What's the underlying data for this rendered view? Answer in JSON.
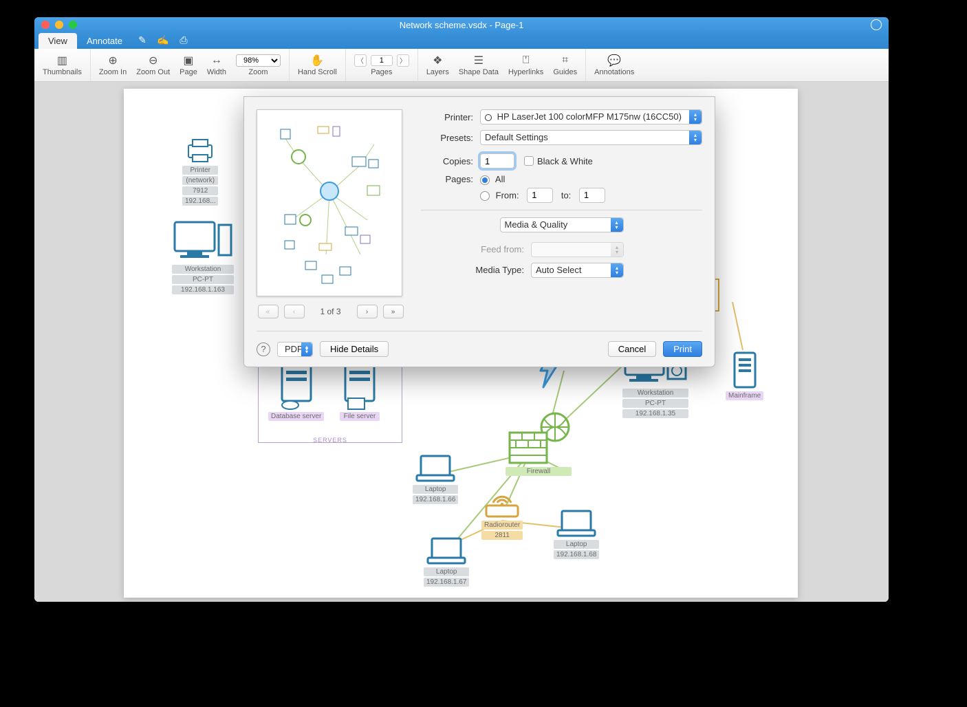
{
  "window": {
    "title": "Network scheme.vsdx - Page-1"
  },
  "tabs": {
    "view": "View",
    "annotate": "Annotate"
  },
  "toolbar": {
    "thumbnails": "Thumbnails",
    "zoom_in": "Zoom In",
    "zoom_out": "Zoom Out",
    "page": "Page",
    "width": "Width",
    "zoom_label": "Zoom",
    "zoom_value": "98%",
    "hand_scroll": "Hand Scroll",
    "pages_label": "Pages",
    "pages_value": "1",
    "layers": "Layers",
    "shape_data": "Shape Data",
    "hyperlinks": "Hyperlinks",
    "guides": "Guides",
    "annotations": "Annotations"
  },
  "diagram": {
    "printer": {
      "name": "Printer",
      "sub": "(network)",
      "id": "7912",
      "ip": "192.168..."
    },
    "ws1": {
      "name": "Workstation",
      "sub": "PC-PT",
      "ip": "192.168.1.163"
    },
    "ws2": {
      "name": "Workstation",
      "sub": "PC-PT",
      "ip": "192.168.1.35"
    },
    "mainframe": {
      "name": "Mainframe"
    },
    "dbserver": {
      "name": "Database server"
    },
    "fileserver": {
      "name": "File server"
    },
    "servers_caption": "SERVERS",
    "firewall": {
      "name": "Firewall"
    },
    "radiorouter": {
      "name": "Radiorouter",
      "id": "2811"
    },
    "laptop1": {
      "name": "Laptop",
      "ip": "192.168.1.66"
    },
    "laptop2": {
      "name": "Laptop",
      "ip": "192.168.1.67"
    },
    "laptop3": {
      "name": "Laptop",
      "ip": "192.168.1.68"
    }
  },
  "dialog": {
    "printer_label": "Printer:",
    "printer_value": "HP LaserJet 100 colorMFP M175nw (16CC50)",
    "presets_label": "Presets:",
    "presets_value": "Default Settings",
    "copies_label": "Copies:",
    "copies_value": "1",
    "bw_label": "Black & White",
    "pages_label": "Pages:",
    "pages_all": "All",
    "pages_from_label": "From:",
    "pages_from_value": "1",
    "pages_to_label": "to:",
    "pages_to_value": "1",
    "section_value": "Media & Quality",
    "feed_label": "Feed from:",
    "feed_value": "",
    "media_label": "Media Type:",
    "media_value": "Auto Select",
    "preview_counter": "1 of 3",
    "pdf_label": "PDF",
    "hide_details": "Hide Details",
    "cancel": "Cancel",
    "print": "Print"
  }
}
